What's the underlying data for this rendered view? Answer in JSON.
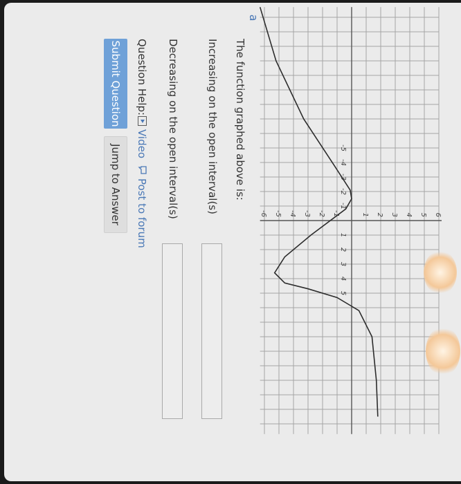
{
  "graph": {
    "x_ticks": [
      "-5",
      "-4",
      "-3",
      "-2",
      "-1",
      "1",
      "2",
      "3",
      "4",
      "5"
    ],
    "y_ticks": [
      "6",
      "5",
      "4",
      "3",
      "2",
      "1",
      "-1",
      "-2",
      "-3",
      "-4",
      "-5",
      "-6"
    ],
    "corner_mark": "a"
  },
  "question": {
    "prompt": "The function graphed above is:",
    "increasing_label": "Increasing on the open interval(s)",
    "increasing_value": "",
    "decreasing_label": "Decreasing on the open interval(s)",
    "decreasing_value": "",
    "help_label": "Question Help:",
    "video_link": "Video",
    "forum_link": "Post to forum",
    "submit_label": "Submit Question",
    "jump_label": "Jump to Answer"
  },
  "colors": {
    "link": "#4a78b6",
    "submit_bg": "#6fa1d8",
    "grid": "#a5a5a5",
    "curve": "#2c2c2c"
  }
}
